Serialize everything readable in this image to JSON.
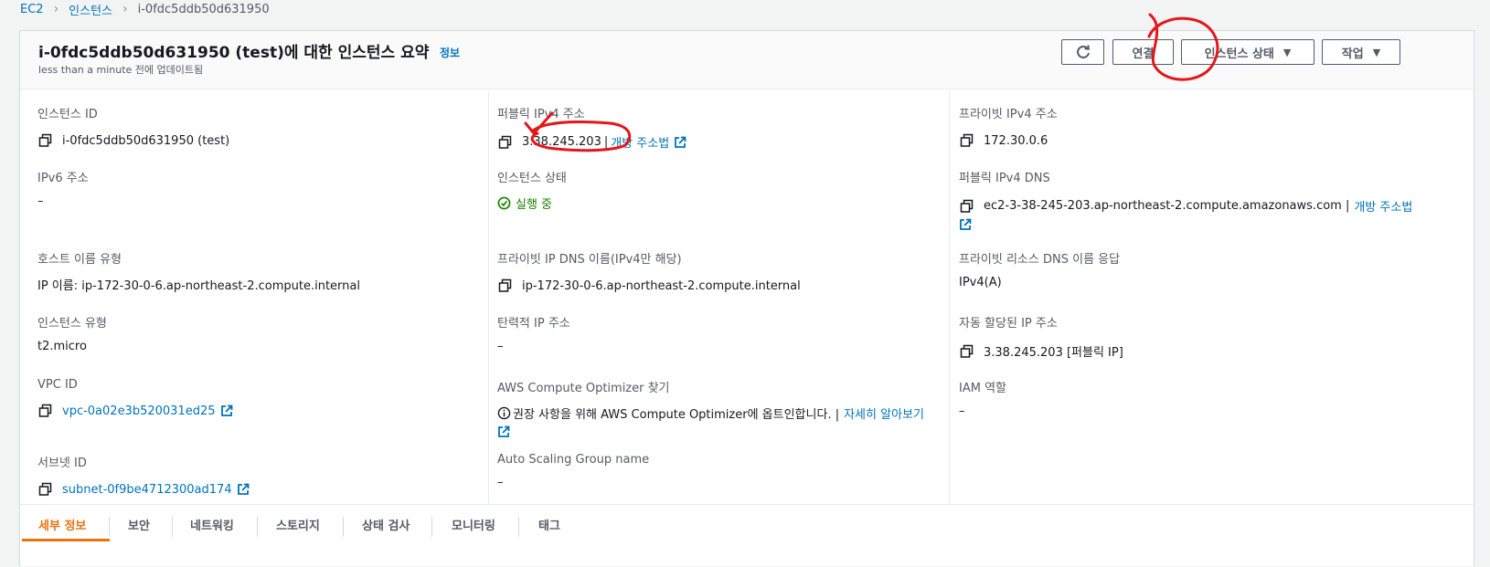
{
  "breadcrumb": {
    "root": "EC2",
    "section": "인스턴스",
    "current": "i-0fdc5ddb50d631950"
  },
  "header": {
    "title": "i-0fdc5ddb50d631950 (test)에 대한 인스턴스 요약",
    "info": "정보",
    "updated": "less than a minute 전에 업데이트됨",
    "connect_label": "연결",
    "state_label": "인스턴스 상태",
    "actions_label": "작업"
  },
  "fields": {
    "instance_id": {
      "label": "인스턴스 ID",
      "value": "i-0fdc5ddb50d631950 (test)"
    },
    "ipv6": {
      "label": "IPv6 주소",
      "value": "–"
    },
    "hostname_type": {
      "label": "호스트 이름 유형",
      "value": "IP 이름: ip-172-30-0-6.ap-northeast-2.compute.internal"
    },
    "instance_type": {
      "label": "인스턴스 유형",
      "value": "t2.micro"
    },
    "vpc_id": {
      "label": "VPC ID",
      "value": "vpc-0a02e3b520031ed25"
    },
    "subnet_id": {
      "label": "서브넷 ID",
      "value": "subnet-0f9be4712300ad174"
    },
    "public_ipv4": {
      "label": "퍼블릭 IPv4 주소",
      "value": "3.38.245.203",
      "sep": "|",
      "link": "개방 주소법"
    },
    "instance_state": {
      "label": "인스턴스 상태",
      "value": "실행 중"
    },
    "private_ip_dns": {
      "label": "프라이빗 IP DNS 이름(IPv4만 해당)",
      "value": "ip-172-30-0-6.ap-northeast-2.compute.internal"
    },
    "elastic_ip": {
      "label": "탄력적 IP 주소",
      "value": "–"
    },
    "optimizer": {
      "label": "AWS Compute Optimizer 찾기",
      "value": "권장 사항을 위해 AWS Compute Optimizer에 옵트인합니다. |",
      "link": "자세히 알아보기"
    },
    "asg": {
      "label": "Auto Scaling Group name",
      "value": "–"
    },
    "private_ipv4": {
      "label": "프라이빗 IPv4 주소",
      "value": "172.30.0.6"
    },
    "public_dns": {
      "label": "퍼블릭 IPv4 DNS",
      "value": "ec2-3-38-245-203.ap-northeast-2.compute.amazonaws.com |",
      "link": "개방 주소법"
    },
    "private_resource_dns": {
      "label": "프라이빗 리소스 DNS 이름 응답",
      "value": "IPv4(A)"
    },
    "auto_ip": {
      "label": "자동 할당된 IP 주소",
      "value": "3.38.245.203 [퍼블릭 IP]"
    },
    "iam_role": {
      "label": "IAM 역할",
      "value": "–"
    }
  },
  "tabs": [
    "세부 정보",
    "보안",
    "네트워킹",
    "스토리지",
    "상태 검사",
    "모니터링",
    "태그"
  ],
  "colors": {
    "link": "#0073bb",
    "accent": "#ec7211",
    "success": "#1d8102",
    "annotation": "#e4161b"
  }
}
